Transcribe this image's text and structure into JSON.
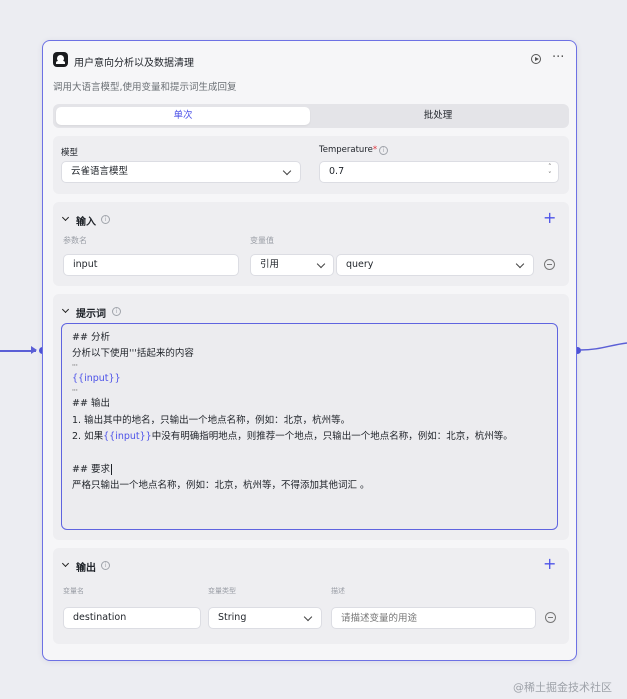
{
  "node": {
    "title": "用户意向分析以及数据清理",
    "description": "调用大语言模型,使用变量和提示词生成回复",
    "run_icon": "play-circle-icon",
    "more_icon": "more-horizontal-icon"
  },
  "tabs": [
    {
      "label": "单次",
      "active": true
    },
    {
      "label": "批处理",
      "active": false
    }
  ],
  "model": {
    "label": "模型",
    "value": "云雀语言模型",
    "temperature_label": "Temperature",
    "temperature_required": "*",
    "temperature_value": "0.7"
  },
  "input": {
    "title": "输入",
    "col_name": "参数名",
    "col_value": "变量值",
    "row": {
      "name": "input",
      "type": "引用",
      "value": "query"
    }
  },
  "prompt": {
    "title": "提示词",
    "lines": [
      "## 分析",
      "分析以下使用'''括起来的内容",
      "'''",
      "{{input}}",
      "'''",
      "## 输出",
      "1. 输出其中的地名，只输出一个地点名称，例如：北京，杭州等。",
      "2. 如果",
      "{{input}}",
      "中没有明确指明地点，则推荐一个地点，只输出一个地点名称，例如：北京，杭州等。",
      "## 要求",
      "严格只输出一个地点名称，例如：北京，杭州等，不得添加其他词汇 。"
    ]
  },
  "output": {
    "title": "输出",
    "col_name": "变量名",
    "col_type": "变量类型",
    "col_desc": "描述",
    "row": {
      "name": "destination",
      "type": "String",
      "desc_placeholder": "请描述变量的用途"
    }
  },
  "watermark": "@稀土掘金技术社区",
  "colors": {
    "accent": "#4d53e8",
    "border": "#6d71e4",
    "required": "#e0363d"
  }
}
